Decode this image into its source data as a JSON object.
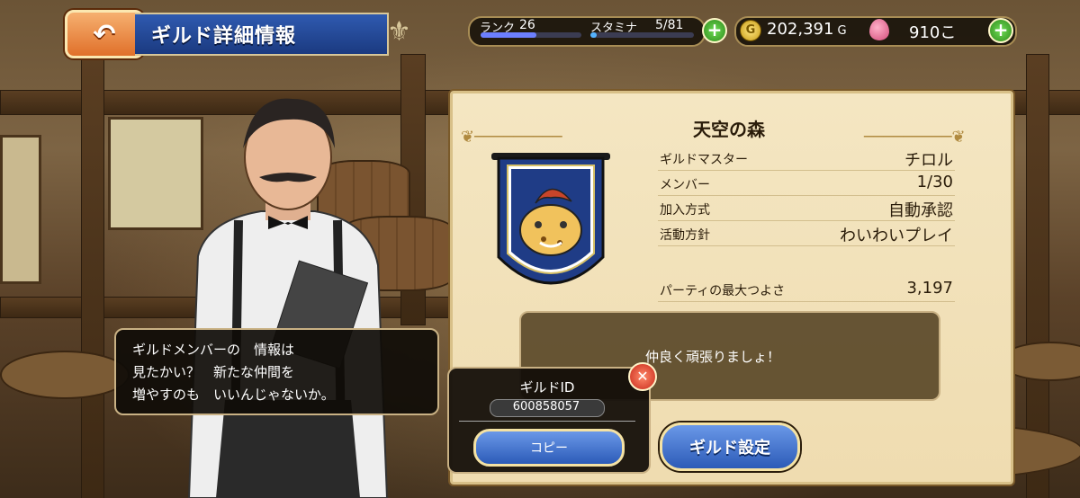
{
  "header": {
    "back_icon": "u-turn-arrow-icon",
    "back_glyph": "↶",
    "title": "ギルド詳細情報"
  },
  "status": {
    "rank_label": "ランク",
    "rank_value": "26",
    "rank_progress": 0.55,
    "stamina_label": "スタミナ",
    "stamina_value": "5/81",
    "stamina_progress": 0.06,
    "gold_icon": "gold-coin-icon",
    "gold_glyph": "G",
    "gold_value": "202,391",
    "gold_unit": "G",
    "gem_value": "910こ",
    "plus_glyph": "+"
  },
  "guild": {
    "name": "天空の森",
    "emblem_icon": "killer-panther-emblem",
    "rows": [
      {
        "label": "ギルドマスター",
        "value": "チロル"
      },
      {
        "label": "メンバー",
        "value": "1/30"
      },
      {
        "label": "加入方式",
        "value": "自動承認"
      },
      {
        "label": "活動方針",
        "value": "わいわいプレイ"
      }
    ],
    "party_label": "パーティの最大つよさ",
    "party_value": "3,197",
    "message": "仲良く頑張りましょ！",
    "settings_button": "ギルド設定"
  },
  "guild_id_popup": {
    "title": "ギルドID",
    "value": "600858057",
    "copy_button": "コピー",
    "close_glyph": "✕"
  },
  "dialogue": {
    "lines": [
      "ギルドメンバーの　情報は",
      "見たかい？　新たな仲間を",
      "増やすのも　いいんじゃないか。"
    ]
  },
  "colors": {
    "accent": "#2c5bb8",
    "back": "#e0702a",
    "parchment": "#f4e6c2"
  }
}
